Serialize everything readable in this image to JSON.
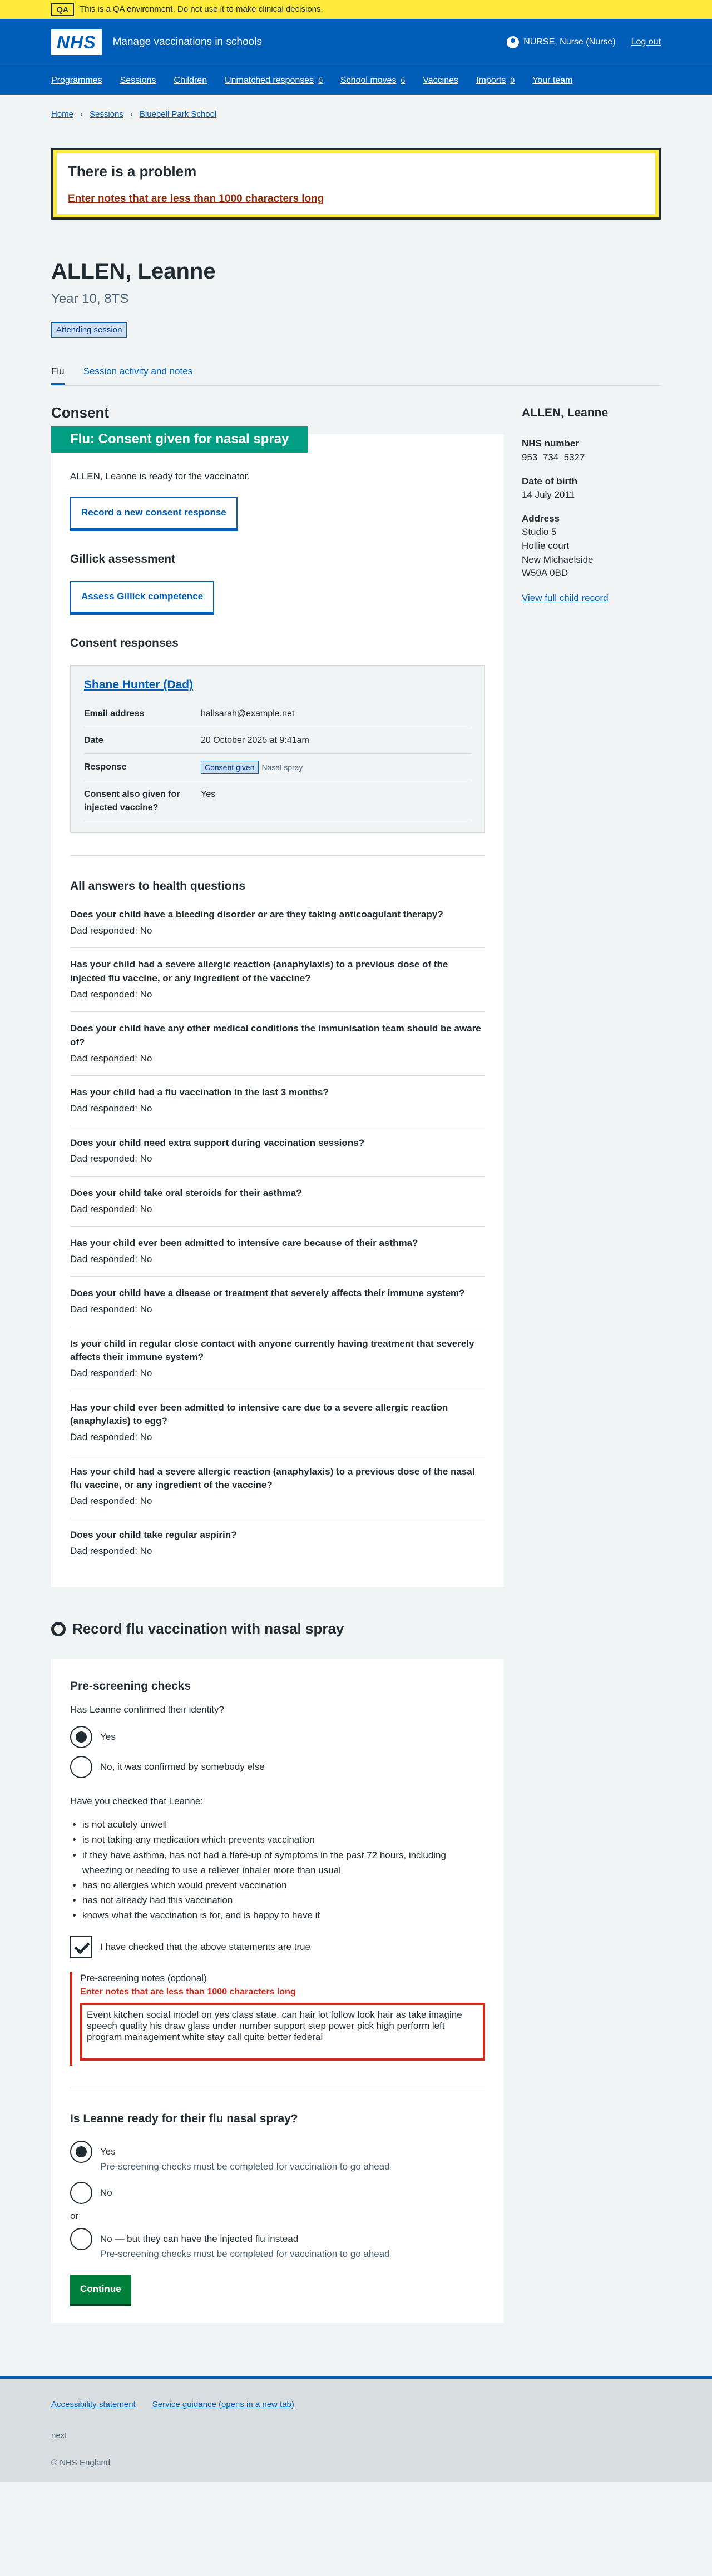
{
  "banner": {
    "tag": "QA",
    "text": "This is a QA environment. Do not use it to make clinical decisions."
  },
  "header": {
    "logo": "NHS",
    "service": "Manage vaccinations in schools",
    "user": "NURSE, Nurse (Nurse)",
    "logout": "Log out",
    "nav": [
      {
        "label": "Programmes",
        "count": ""
      },
      {
        "label": "Sessions",
        "count": ""
      },
      {
        "label": "Children",
        "count": ""
      },
      {
        "label": "Unmatched responses",
        "count": "0"
      },
      {
        "label": "School moves",
        "count": "6"
      },
      {
        "label": "Vaccines",
        "count": ""
      },
      {
        "label": "Imports",
        "count": "0"
      },
      {
        "label": "Your team",
        "count": ""
      }
    ]
  },
  "breadcrumbs": [
    "Home",
    "Sessions",
    "Bluebell Park School"
  ],
  "error_summary": {
    "title": "There is a problem",
    "message": "Enter notes that are less than 1000 characters long"
  },
  "patient": {
    "name": "ALLEN, Leanne",
    "year": "Year 10, 8TS",
    "status": "Attending session"
  },
  "tabs": [
    "Flu",
    "Session activity and notes"
  ],
  "consent": {
    "heading": "Consent",
    "card_title": "Flu: Consent given for nasal spray",
    "ready_text": "ALLEN, Leanne is ready for the vaccinator.",
    "record_button": "Record a new consent response",
    "gillick_heading": "Gillick assessment",
    "gillick_button": "Assess Gillick competence",
    "responses_heading": "Consent responses",
    "response": {
      "name": "Shane Hunter (Dad)",
      "rows": [
        {
          "k": "Email address",
          "v": "hallsarah@example.net"
        },
        {
          "k": "Date",
          "v": "20 October 2025 at 9:41am"
        },
        {
          "k": "Response",
          "v": "Consent given",
          "extra": "Nasal spray"
        },
        {
          "k": "Consent also given for injected vaccine?",
          "v": "Yes"
        }
      ]
    },
    "health_heading": "All answers to health questions",
    "health": [
      {
        "q": "Does your child have a bleeding disorder or are they taking anticoagulant therapy?",
        "a": "Dad responded: No"
      },
      {
        "q": "Has your child had a severe allergic reaction (anaphylaxis) to a previous dose of the injected flu vaccine, or any ingredient of the vaccine?",
        "a": "Dad responded: No"
      },
      {
        "q": "Does your child have any other medical conditions the immunisation team should be aware of?",
        "a": "Dad responded: No"
      },
      {
        "q": "Has your child had a flu vaccination in the last 3 months?",
        "a": "Dad responded: No"
      },
      {
        "q": "Does your child need extra support during vaccination sessions?",
        "a": "Dad responded: No"
      },
      {
        "q": "Does your child take oral steroids for their asthma?",
        "a": "Dad responded: No"
      },
      {
        "q": "Has your child ever been admitted to intensive care because of their asthma?",
        "a": "Dad responded: No"
      },
      {
        "q": "Does your child have a disease or treatment that severely affects their immune system?",
        "a": "Dad responded: No"
      },
      {
        "q": "Is your child in regular close contact with anyone currently having treatment that severely affects their immune system?",
        "a": "Dad responded: No"
      },
      {
        "q": "Has your child ever been admitted to intensive care due to a severe allergic reaction (anaphylaxis) to egg?",
        "a": "Dad responded: No"
      },
      {
        "q": "Has your child had a severe allergic reaction (anaphylaxis) to a previous dose of the nasal flu vaccine, or any ingredient of the vaccine?",
        "a": "Dad responded: No"
      },
      {
        "q": "Does your child take regular aspirin?",
        "a": "Dad responded: No"
      }
    ]
  },
  "sidebar": {
    "name": "ALLEN, Leanne",
    "nhs_label": "NHS number",
    "nhs": "953  734  5327",
    "dob_label": "Date of birth",
    "dob": "14 July 2011",
    "address_label": "Address",
    "address": [
      "Studio 5",
      "Hollie court",
      "New Michaelside",
      "W50A 0BD"
    ],
    "link": "View full child record"
  },
  "record": {
    "title": "Record flu vaccination with nasal spray",
    "prescreen_heading": "Pre-screening checks",
    "identity_q": "Has Leanne confirmed their identity?",
    "identity_yes": "Yes",
    "identity_no": "No, it was confirmed by somebody else",
    "checked_q": "Have you checked that Leanne:",
    "checks": [
      "is not acutely unwell",
      "is not taking any medication which prevents vaccination",
      "if they have asthma, has not had a flare-up of symptoms in the past 72 hours, including wheezing or needing to use a reliever inhaler more than usual",
      "has no allergies which would prevent vaccination",
      "has not already had this vaccination",
      "knows what the vaccination is for, and is happy to have it"
    ],
    "confirm_label": "I have checked that the above statements are true",
    "notes_label": "Pre-screening notes (optional)",
    "notes_error": "Enter notes that are less than 1000 characters long",
    "notes_value": "Event kitchen social model on yes class state. can hair lot follow look hair as take imagine speech quality his draw glass under number support step power pick high perform left program management white stay call quite better federal",
    "ready_heading": "Is Leanne ready for their flu nasal spray?",
    "opt_yes": "Yes",
    "opt_yes_hint": "Pre-screening checks must be completed for vaccination to go ahead",
    "opt_no": "No",
    "or": "or",
    "opt_alt": "No — but they can have the injected flu instead",
    "opt_alt_hint": "Pre-screening checks must be completed for vaccination to go ahead",
    "continue": "Continue"
  },
  "footer": {
    "links": [
      "Accessibility statement",
      "Service guidance (opens in a new tab)"
    ],
    "small": "next",
    "copy": "© NHS England"
  }
}
